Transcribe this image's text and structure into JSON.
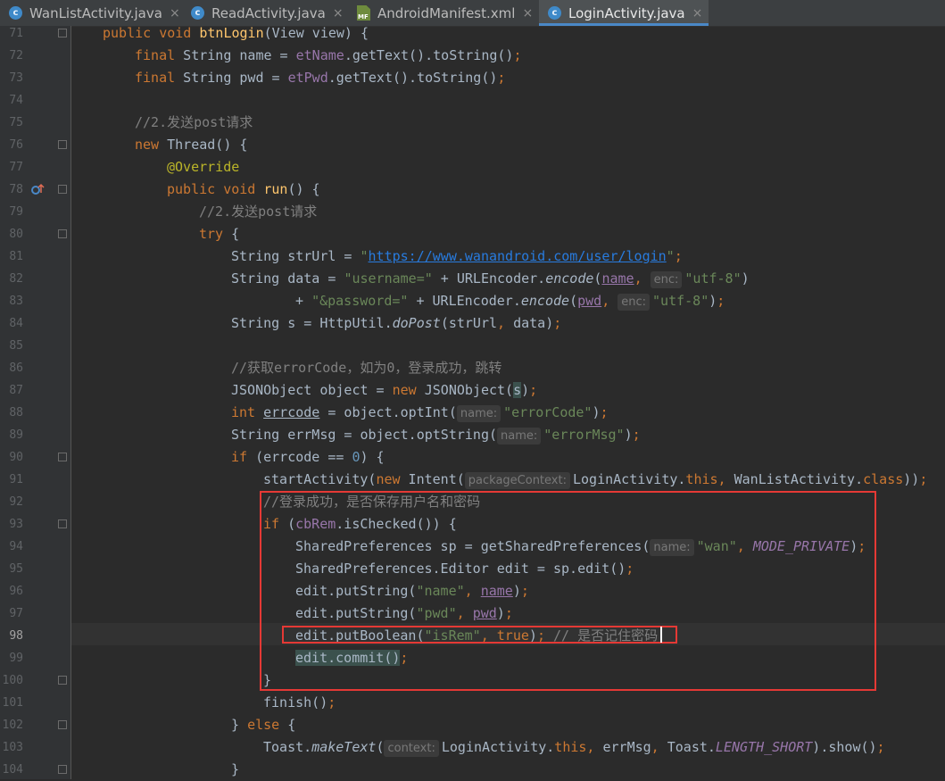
{
  "tabs": [
    {
      "label": "WanListActivity.java",
      "icon": "java-class-icon",
      "icon_text": "c",
      "active": false
    },
    {
      "label": "ReadActivity.java",
      "icon": "java-class-icon",
      "icon_text": "c",
      "active": false
    },
    {
      "label": "AndroidManifest.xml",
      "icon": "manifest-file-icon",
      "icon_text": "MF",
      "active": false
    },
    {
      "label": "LoginActivity.java",
      "icon": "java-class-icon",
      "icon_text": "c",
      "active": true
    }
  ],
  "close_glyph": "×",
  "editor": {
    "current_line": 98,
    "line_numbers": [
      "71",
      "72",
      "73",
      "74",
      "75",
      "76",
      "77",
      "78",
      "79",
      "80",
      "81",
      "82",
      "83",
      "84",
      "85",
      "86",
      "87",
      "88",
      "89",
      "90",
      "91",
      "92",
      "93",
      "94",
      "95",
      "96",
      "97",
      "98",
      "99",
      "100",
      "101",
      "102",
      "103",
      "104"
    ],
    "gutter_marker_line_78": "overriding-method-icon",
    "code": {
      "l71": {
        "t1": "public",
        "t2": " ",
        "t3": "void",
        "t4": " ",
        "t5": "btnLogin",
        "t6": "(View view) {"
      },
      "l72": {
        "t1": "final",
        "t2": " String name = ",
        "t3": "etName",
        "t4": ".getText().toString()",
        "t5": ";"
      },
      "l73": {
        "t1": "final",
        "t2": " String pwd = ",
        "t3": "etPwd",
        "t4": ".getText().toString()",
        "t5": ";"
      },
      "l75": {
        "t1": "//2.发送post请求"
      },
      "l76": {
        "t1": "new",
        "t2": " Thread() {"
      },
      "l77": {
        "t1": "@Override"
      },
      "l78": {
        "t1": "public",
        "t2": " ",
        "t3": "void",
        "t4": " ",
        "t5": "run",
        "t6": "() {"
      },
      "l79": {
        "t1": "//2.发送post请求"
      },
      "l80": {
        "t1": "try",
        "t2": " {"
      },
      "l81": {
        "t1": "String strUrl = ",
        "t2": "\"",
        "t3": "https://www.wanandroid.com/user/login",
        "t4": "\"",
        "t5": ";"
      },
      "l82": {
        "t1": "String data = ",
        "t2": "\"username=\"",
        "t3": " + URLEncoder.",
        "t4": "encode",
        "t5": "(",
        "t6": "name",
        "t7": ",",
        "t8": "enc:",
        "t9": "\"utf-8\"",
        "t10": ")"
      },
      "l83": {
        "t1": "+ ",
        "t2": "\"&password=\"",
        "t3": " + URLEncoder.",
        "t4": "encode",
        "t5": "(",
        "t6": "pwd",
        "t7": ",",
        "t8": "enc:",
        "t9": "\"utf-8\"",
        "t10": ")",
        "t11": ";"
      },
      "l84": {
        "t1": "String s = HttpUtil.",
        "t2": "doPost",
        "t3": "(strUrl",
        "t4": ",",
        "t5": " data)",
        "t6": ";"
      },
      "l86": {
        "t1": "//获取errorCode，如为0，登录成功，跳转"
      },
      "l87": {
        "t1": "JSONObject object = ",
        "t2": "new",
        "t3": " JSONObject(",
        "t4": "s",
        "t5": ")",
        "t6": ";"
      },
      "l88": {
        "t1": "int",
        "t2": " ",
        "t3": "errcode",
        "t4": " = object.optInt(",
        "t5": "name:",
        "t6": "\"errorCode\"",
        "t7": ")",
        "t8": ";"
      },
      "l89": {
        "t1": "String errMsg = object.optString(",
        "t2": "name:",
        "t3": "\"errorMsg\"",
        "t4": ")",
        "t5": ";"
      },
      "l90": {
        "t1": "if",
        "t2": " (errcode == ",
        "t3": "0",
        "t4": ") {"
      },
      "l91": {
        "t1": "startActivity(",
        "t2": "new",
        "t3": " Intent(",
        "t4": "packageContext:",
        "t5": "LoginActivity.",
        "t6": "this",
        "t7": ",",
        "t8": " WanListActivity.",
        "t9": "class",
        "t10": "))",
        "t11": ";"
      },
      "l92": {
        "t1": "//登录成功，是否保存用户名和密码"
      },
      "l93": {
        "t1": "if",
        "t2": " (",
        "t3": "cbRem",
        "t4": ".isChecked()) {"
      },
      "l94": {
        "t1": "SharedPreferences sp = getSharedPreferences(",
        "t2": "name:",
        "t3": "\"wan\"",
        "t4": ",",
        "t5": " ",
        "t6": "MODE_PRIVATE",
        "t7": ")",
        "t8": ";"
      },
      "l95": {
        "t1": "SharedPreferences.Editor edit = sp.edit()",
        "t2": ";"
      },
      "l96": {
        "t1": "edit.putString(",
        "t2": "\"name\"",
        "t3": ",",
        "t4": " ",
        "t5": "name",
        "t6": ")",
        "t7": ";"
      },
      "l97": {
        "t1": "edit.putString(",
        "t2": "\"pwd\"",
        "t3": ",",
        "t4": " ",
        "t5": "pwd",
        "t6": ")",
        "t7": ";"
      },
      "l98": {
        "t1": "edit.putBoolean(",
        "t2": "\"isRem\"",
        "t3": ",",
        "t4": " ",
        "t5": "true",
        "t6": ")",
        "t7": ";",
        "t8": " // 是否记住密码"
      },
      "l99": {
        "t1": "edit.commit()",
        "t2": ";"
      },
      "l100": {
        "t1": "}"
      },
      "l101": {
        "t1": "finish()",
        "t2": ";"
      },
      "l102": {
        "t1": "} ",
        "t2": "else",
        "t3": " {"
      },
      "l103": {
        "t1": "Toast.",
        "t2": "makeText",
        "t3": "(",
        "t4": "context:",
        "t5": "LoginActivity.",
        "t6": "this",
        "t7": ",",
        "t8": " errMsg",
        "t9": ",",
        "t10": " Toast.",
        "t11": "LENGTH_SHORT",
        "t12": ").show()",
        "t13": ";"
      },
      "l104": {
        "t1": "}"
      }
    }
  },
  "annotations": {
    "highlight_color": "#e53935"
  }
}
